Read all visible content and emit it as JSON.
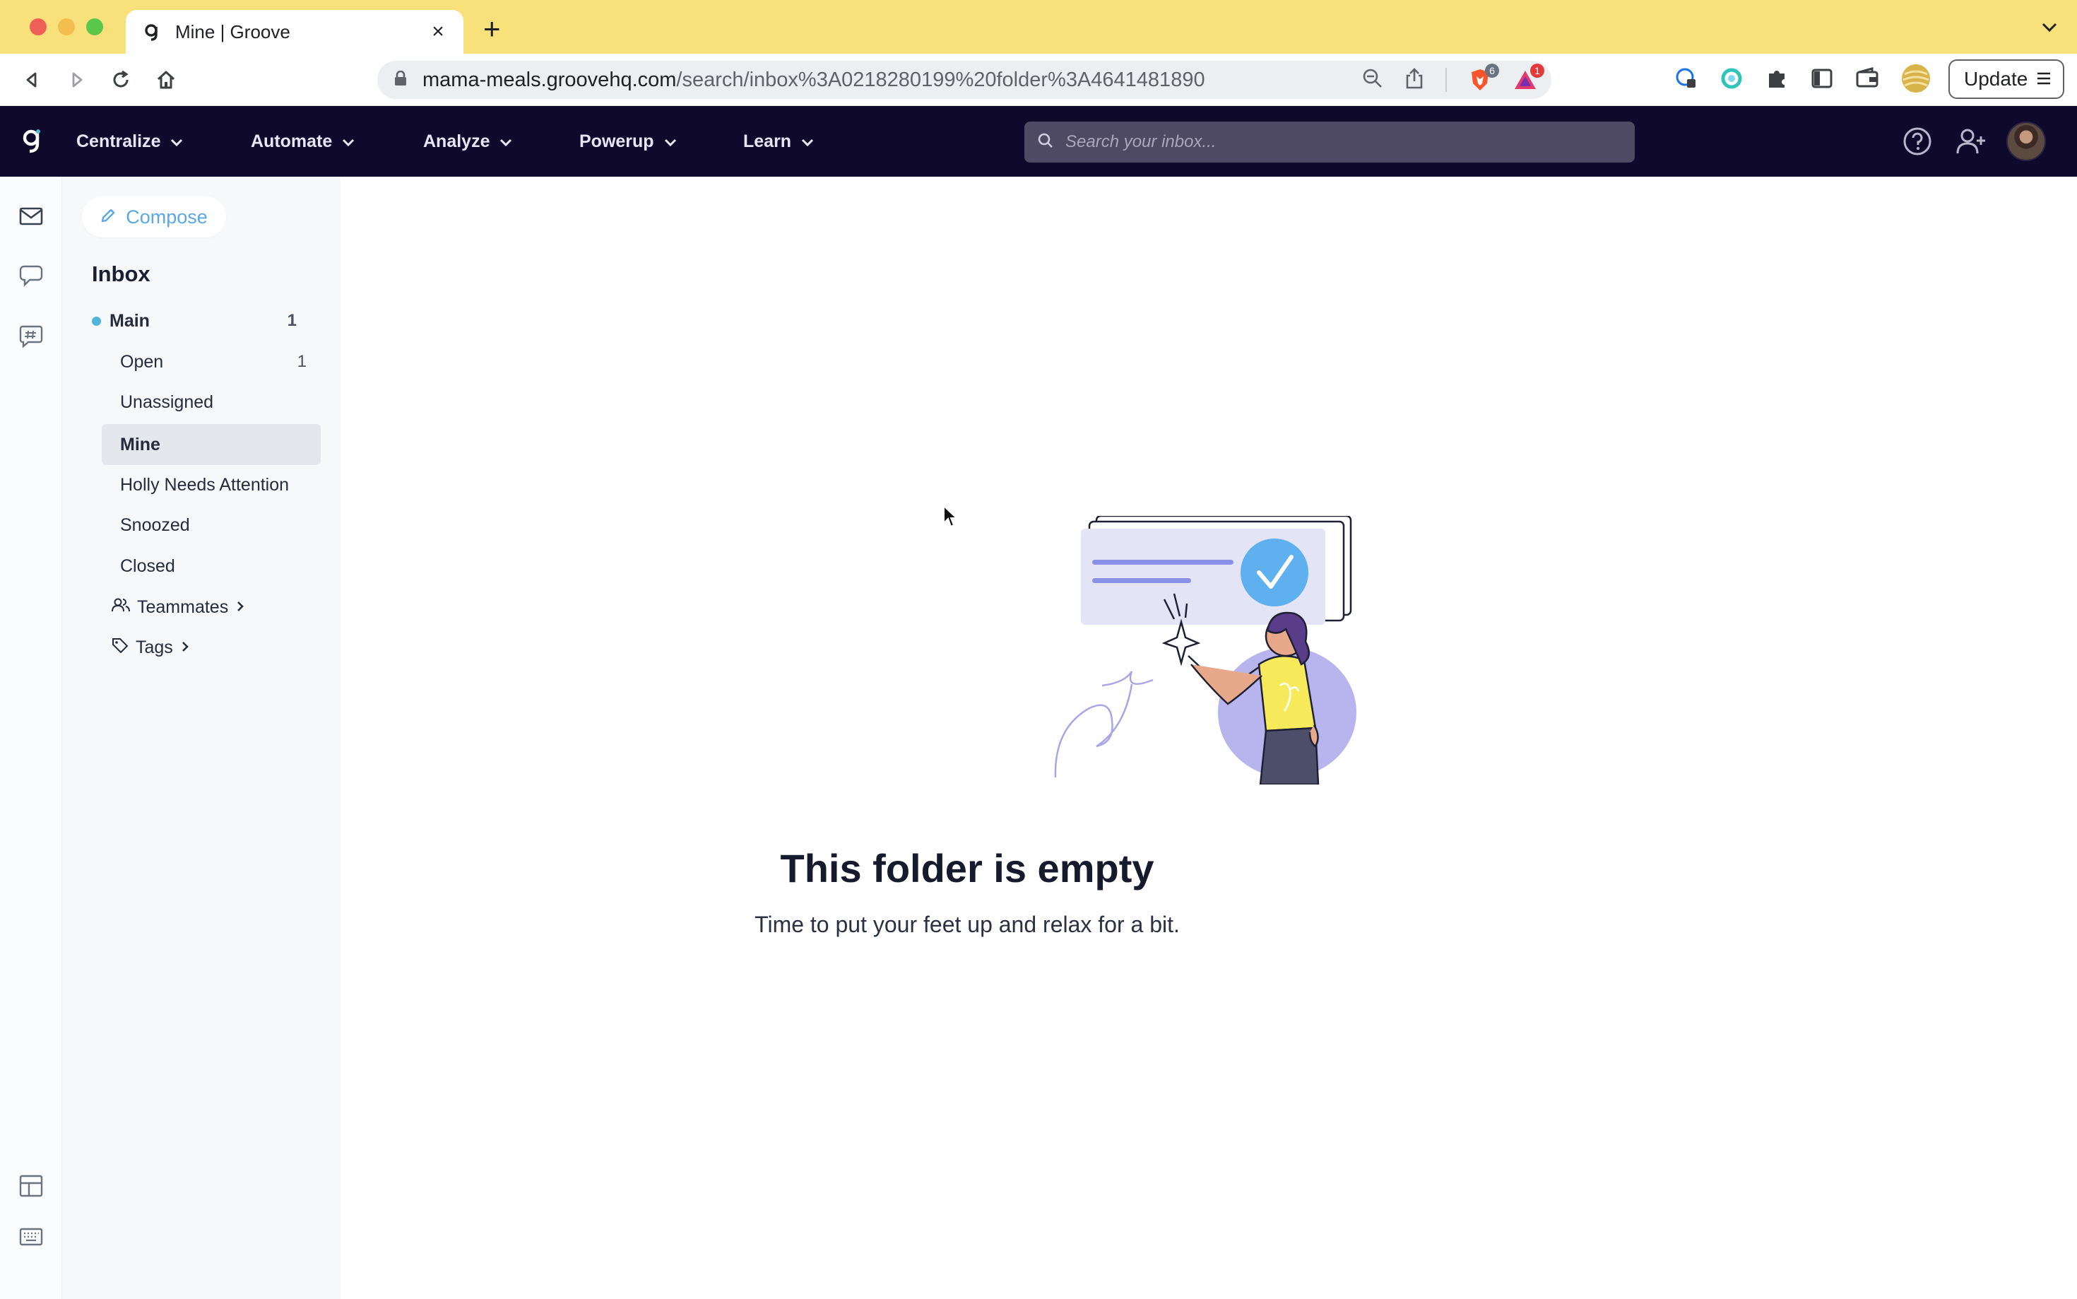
{
  "browser": {
    "tab_title": "Mine | Groove",
    "url_host": "mama-meals.groovehq.com",
    "url_path": "/search/inbox%3A0218280199%20folder%3A4641481890",
    "brave_badge": "6",
    "rewards_badge": "1",
    "update_label": "Update"
  },
  "appnav": {
    "items": [
      {
        "label": "Centralize"
      },
      {
        "label": "Automate"
      },
      {
        "label": "Analyze"
      },
      {
        "label": "Powerup"
      },
      {
        "label": "Learn"
      }
    ],
    "search_placeholder": "Search your inbox..."
  },
  "sidebar": {
    "compose_label": "Compose",
    "inbox_title": "Inbox",
    "main": {
      "label": "Main",
      "count": "1"
    },
    "folders": [
      {
        "label": "Open",
        "count": "1"
      },
      {
        "label": "Unassigned",
        "count": ""
      },
      {
        "label": "Mine",
        "count": ""
      },
      {
        "label": "Holly Needs Attention",
        "count": ""
      },
      {
        "label": "Snoozed",
        "count": ""
      },
      {
        "label": "Closed",
        "count": ""
      }
    ],
    "teammates_label": "Teammates",
    "tags_label": "Tags"
  },
  "empty_state": {
    "title": "This folder is empty",
    "subtitle": "Time to put your feet up and relax for a bit."
  },
  "colors": {
    "tabstrip": "#f8e07a",
    "appnav": "#0f0a2b",
    "accent": "#5aa9e6",
    "active_folder": "#e4e7eb"
  }
}
